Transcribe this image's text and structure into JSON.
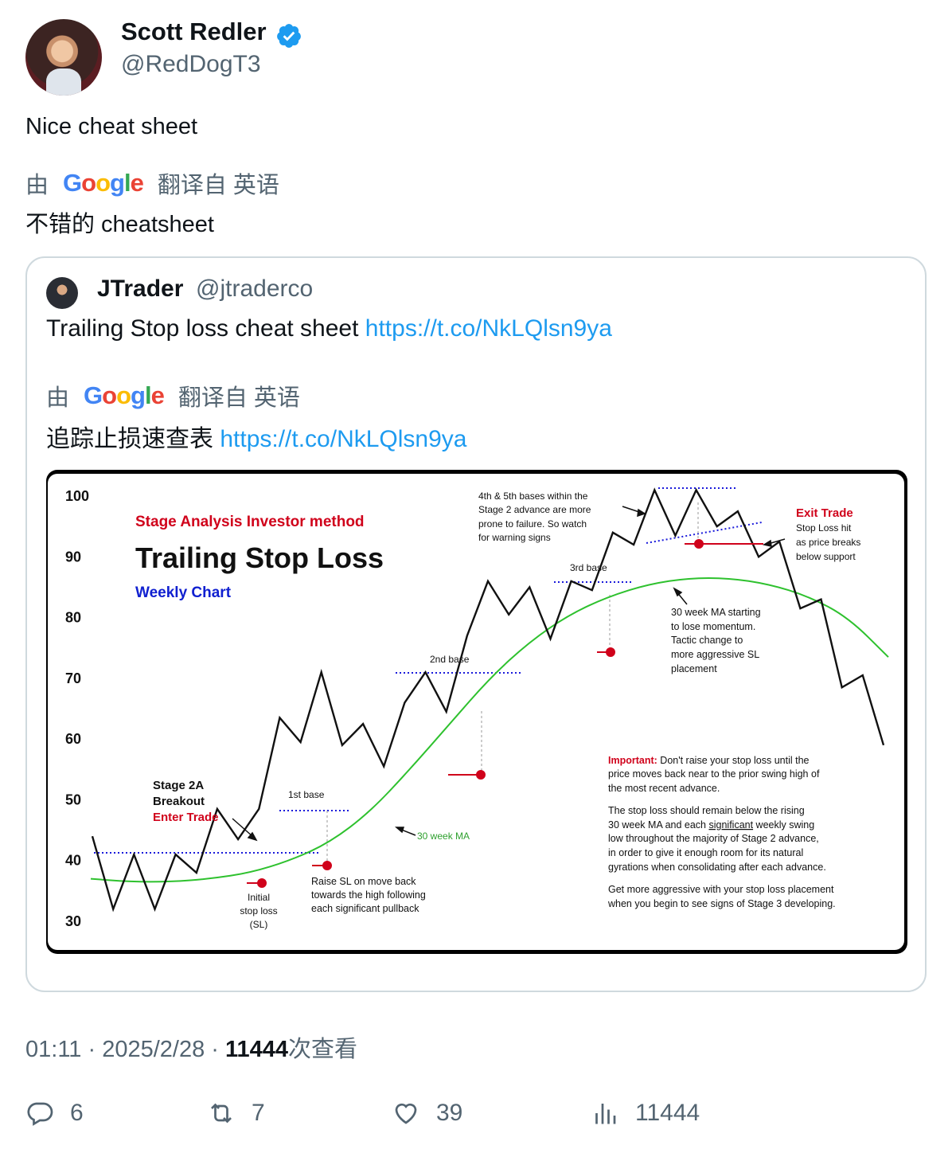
{
  "author": {
    "name": "Scott Redler",
    "handle": "@RedDogT3"
  },
  "tweet": {
    "text": "Nice cheat sheet",
    "translate_by": "由",
    "translate_brand": "Google",
    "translate_from": "翻译自 英语",
    "translated": "不错的 cheatsheet"
  },
  "quote": {
    "name": "JTrader",
    "handle": "@jtraderco",
    "text": "Trailing Stop loss cheat sheet ",
    "link": "https://t.co/NkLQlsn9ya",
    "translate_by": "由",
    "translate_brand": "Google",
    "translate_from": "翻译自 英语",
    "translated": "追踪止损速查表 ",
    "translated_link": "https://t.co/NkLQlsn9ya"
  },
  "chart_data": {
    "type": "line",
    "subtitle_top": "Stage Analysis Investor method",
    "title": "Trailing Stop Loss",
    "subtitle": "Weekly Chart",
    "yticks": [
      100,
      90,
      80,
      70,
      60,
      50,
      40,
      30
    ],
    "ylim": [
      30,
      100
    ],
    "series": [
      {
        "name": "price",
        "values": [
          44,
          32,
          41,
          32,
          41,
          38,
          48.5,
          43.5,
          48.5,
          63.5,
          59.5,
          71,
          59,
          62.5,
          55.5,
          66,
          71,
          64.5,
          77,
          86,
          80.5,
          85,
          76.5,
          86,
          84.5,
          94,
          92,
          101,
          93.5,
          101,
          95,
          97.5,
          90,
          92.5,
          81.5,
          83,
          68.5,
          70.5,
          59
        ]
      },
      {
        "name": "30 week MA",
        "values": [
          37,
          36.5,
          36.5,
          37,
          38,
          40,
          43,
          48,
          55,
          62.5,
          70,
          76,
          80.5,
          83.5,
          85.5,
          86.5,
          86.5,
          85.5,
          83.5,
          80,
          73.5
        ]
      }
    ],
    "annotations": {
      "stage": "Stage 2A",
      "breakout": "Breakout",
      "enter": "Enter Trade",
      "initial1": "Initial",
      "initial2": "stop loss",
      "initial3": "(SL)",
      "base1": "1st base",
      "base2": "2nd base",
      "base3": "3rd base",
      "raise1": "Raise SL on move back",
      "raise2": "towards the high following",
      "raise3": "each significant pullback",
      "ma_label": "30 week MA",
      "warn1": "4th & 5th bases within the",
      "warn2": "Stage 2 advance are more",
      "warn3": "prone to failure. So watch",
      "warn4": "for warning signs",
      "exit_title": "Exit Trade",
      "exit1": "Stop Loss hit",
      "exit2": "as price breaks",
      "exit3": "below support",
      "mom1": "30 week MA starting",
      "mom2": "to lose momentum.",
      "mom3": "Tactic change to",
      "mom4": "more aggressive SL",
      "mom5": "placement",
      "imp_label": "Important:",
      "imp1": " Don't raise your stop loss until the",
      "imp2": "price moves back near to the prior swing high of",
      "imp3": "the most recent advance.",
      "rule1": "The stop loss should remain below the rising",
      "rule2a": "30 week MA and each ",
      "rule2b": "significant",
      "rule2c": " weekly swing",
      "rule3": "low throughout the majority of Stage 2 advance,",
      "rule4": "in order to give it enough room for its natural",
      "rule5": "gyrations when consolidating after each advance.",
      "agg1": "Get more aggressive with your stop loss placement",
      "agg2": "when you begin to see signs of Stage 3 developing."
    },
    "colors": {
      "price": "#111111",
      "ma": "#2ec12e",
      "stop": "#d0021b",
      "base": "#1a1adb",
      "title_red": "#d0021b",
      "title_blue": "#1020d0"
    }
  },
  "footer": {
    "time": "01:11",
    "date": "2025/2/28",
    "views": "11444",
    "views_label": "次查看"
  },
  "actions": {
    "replies": "6",
    "retweets": "7",
    "likes": "39",
    "views": "11444"
  }
}
